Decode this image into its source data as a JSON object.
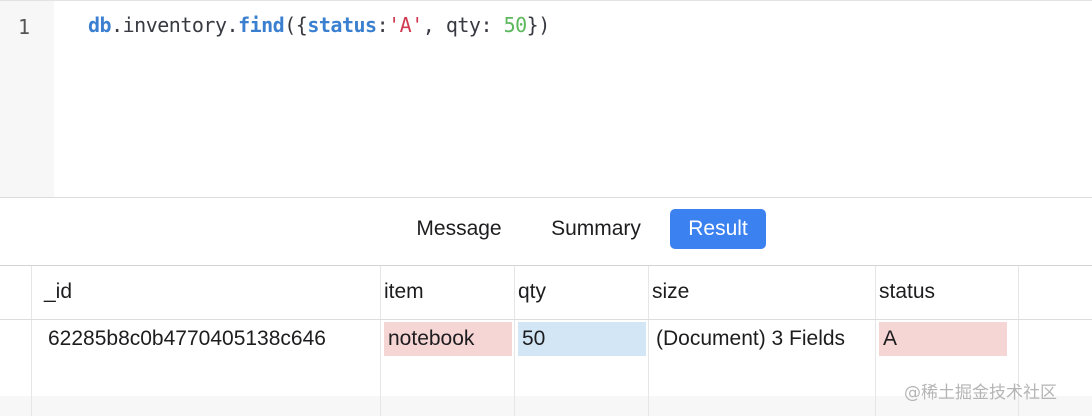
{
  "editor": {
    "line_number": "1",
    "tokens": {
      "db": "db",
      "dot1": ".",
      "inventory": "inventory",
      "dot2": ".",
      "find": "find",
      "open": "({",
      "status_key": "status",
      "colon1": ":",
      "status_val": "'A'",
      "comma": ", ",
      "qty_key": "qty",
      "colon2": ": ",
      "qty_val": "50",
      "close": "})"
    }
  },
  "tabs": {
    "message": "Message",
    "summary": "Summary",
    "result": "Result",
    "active": "Result",
    "active_color": "#3b82f0"
  },
  "grid": {
    "columns": [
      "_id",
      "item",
      "qty",
      "size",
      "status"
    ],
    "rows": [
      {
        "_id": "62285b8c0b4770405138c646",
        "item": "notebook",
        "qty": "50",
        "size": "(Document) 3 Fields",
        "status": "A"
      }
    ],
    "highlight_colors": {
      "string": "#f6d5d5",
      "number": "#d3e6f6"
    }
  },
  "watermark": "@稀土掘金技术社区"
}
